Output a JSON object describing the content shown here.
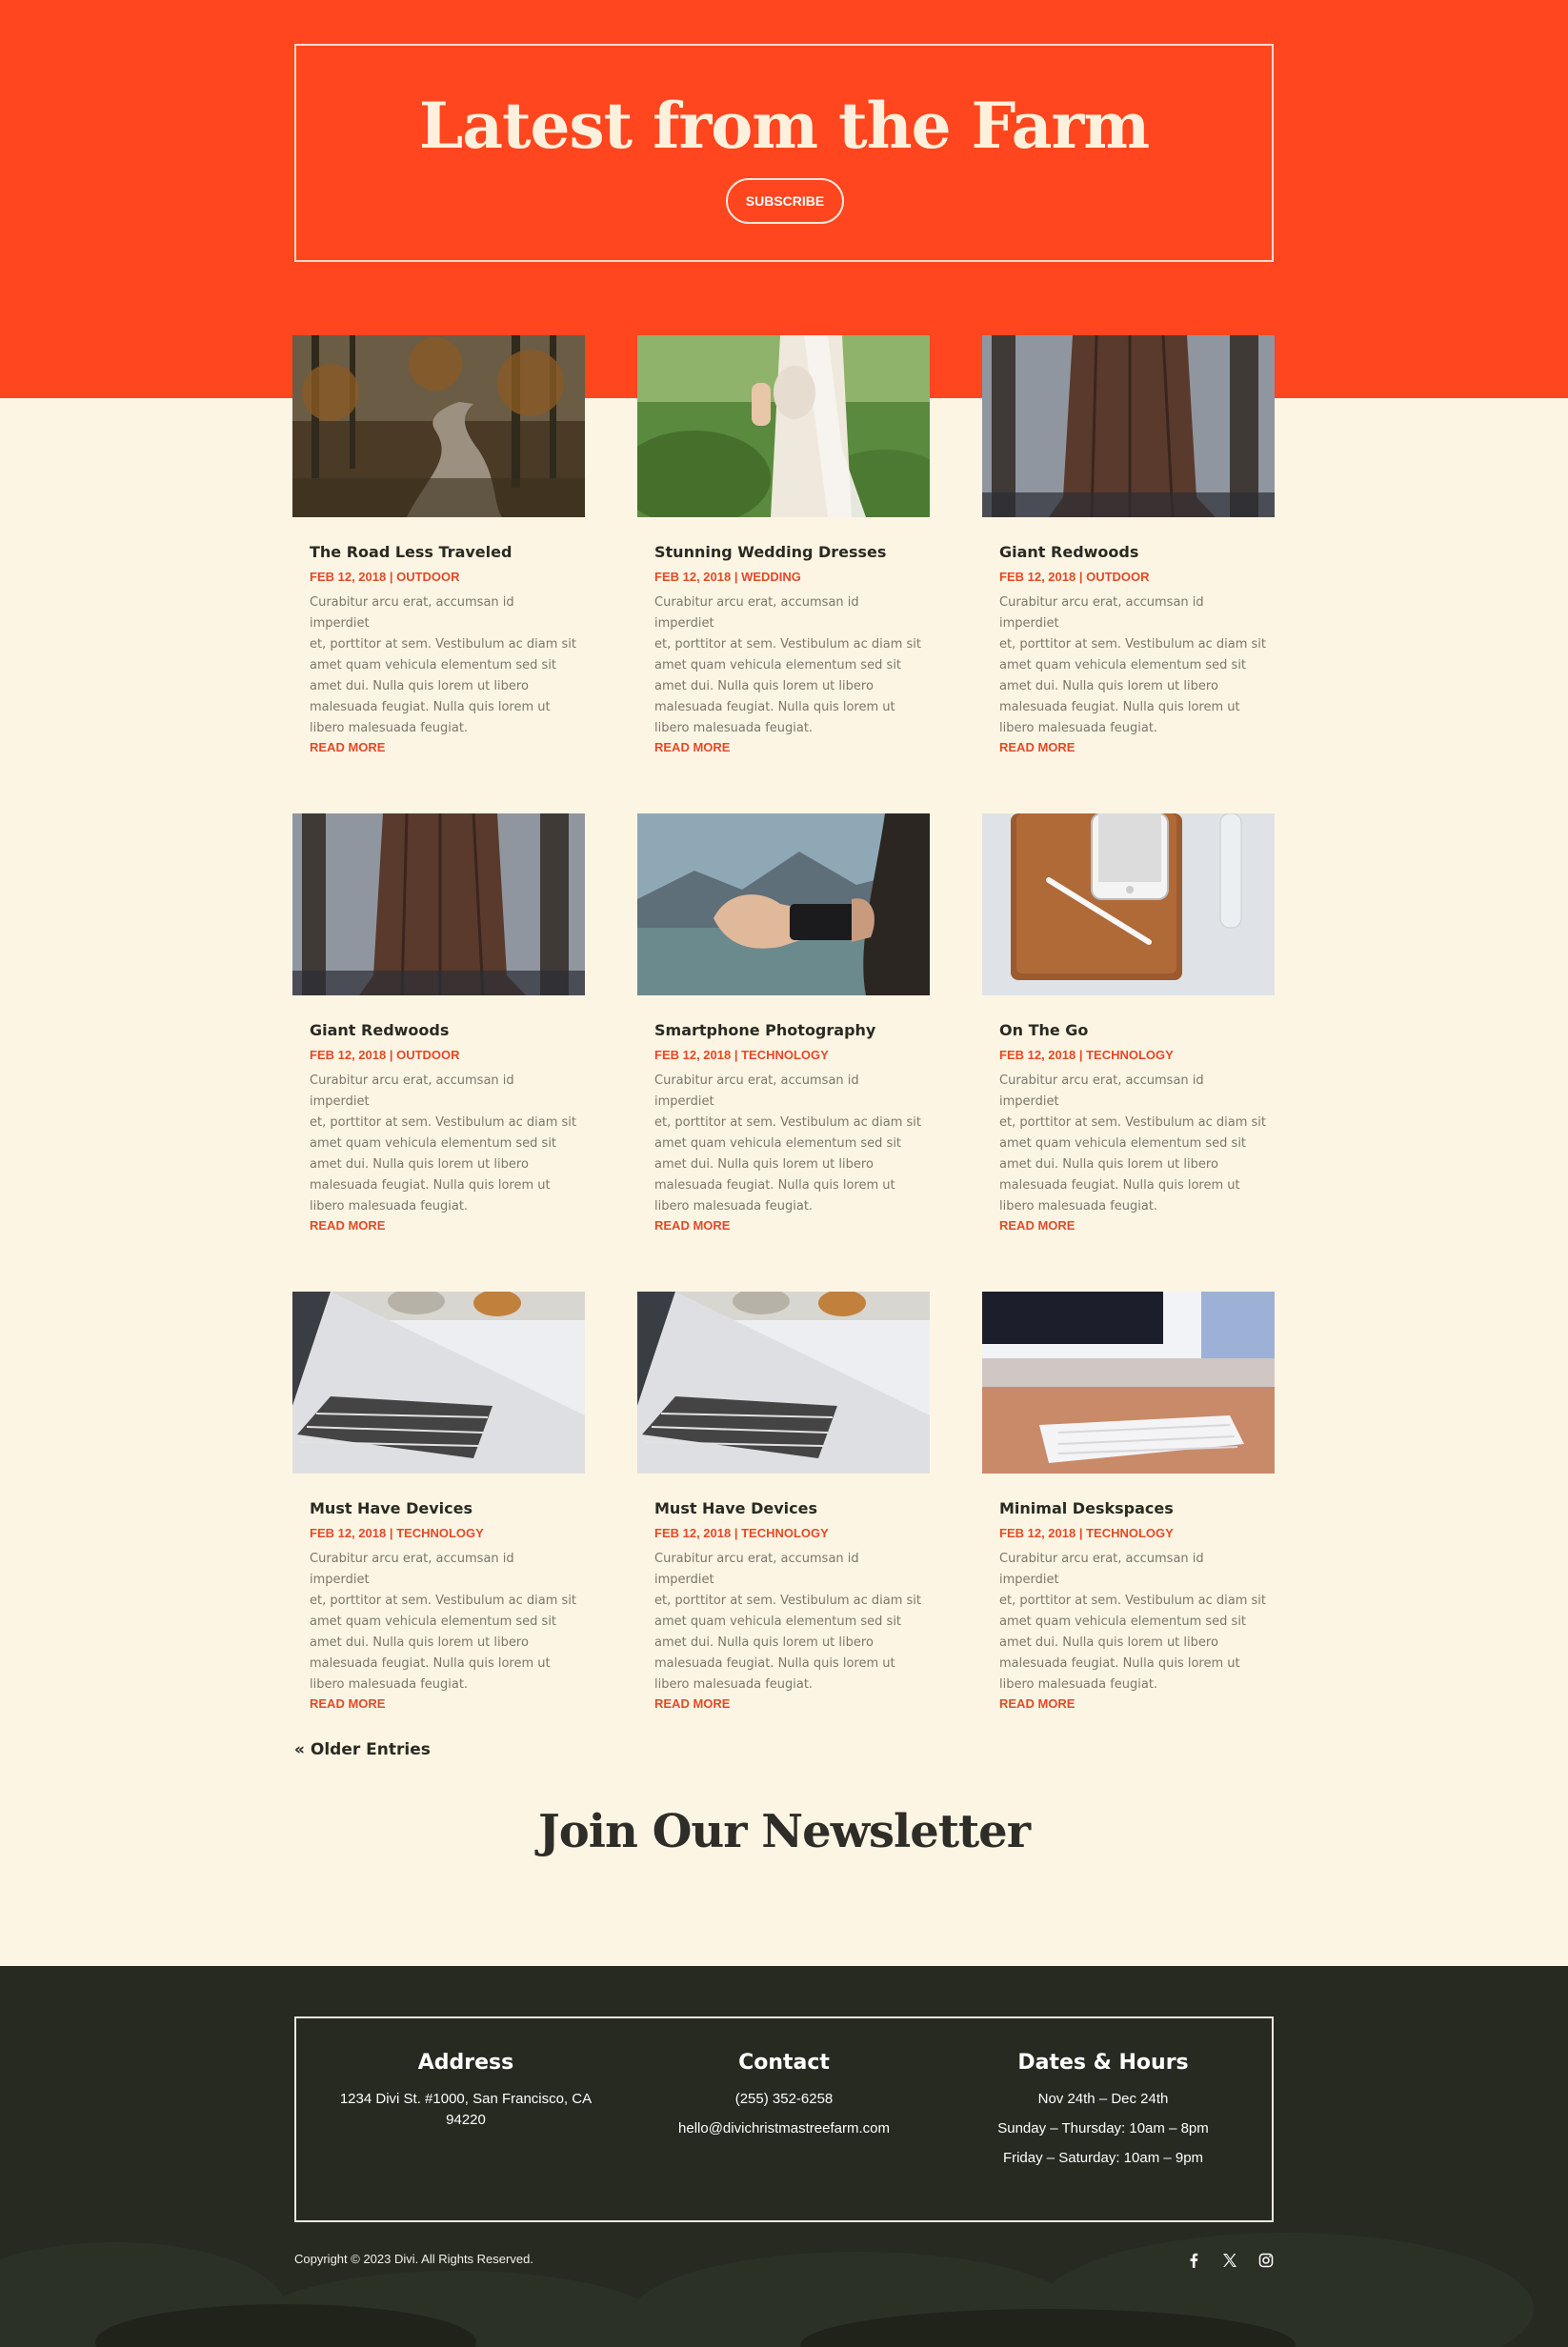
{
  "hero": {
    "title": "Latest from the Farm",
    "subscribe_label": "SUBSCRIBE"
  },
  "posts": [
    {
      "title": "The Road Less Traveled",
      "date": "FEB 12, 2018",
      "category": "OUTDOOR",
      "image": "forest-road-photo"
    },
    {
      "title": "Stunning Wedding Dresses",
      "date": "FEB 12, 2018",
      "category": "WEDDING",
      "image": "bride-dress-photo"
    },
    {
      "title": "Giant Redwoods",
      "date": "FEB 12, 2018",
      "category": "OUTDOOR",
      "image": "redwood-trees-photo"
    },
    {
      "title": "Giant Redwoods",
      "date": "FEB 12, 2018",
      "category": "OUTDOOR",
      "image": "redwood-trees-photo"
    },
    {
      "title": "Smartphone Photography",
      "date": "FEB 12, 2018",
      "category": "TECHNOLOGY",
      "image": "phone-camera-photo"
    },
    {
      "title": "On The Go",
      "date": "FEB 12, 2018",
      "category": "TECHNOLOGY",
      "image": "tablet-phone-photo"
    },
    {
      "title": "Must Have Devices",
      "date": "FEB 12, 2018",
      "category": "TECHNOLOGY",
      "image": "laptop-keyboard-photo"
    },
    {
      "title": "Must Have Devices",
      "date": "FEB 12, 2018",
      "category": "TECHNOLOGY",
      "image": "laptop-keyboard-photo"
    },
    {
      "title": "Minimal Deskspaces",
      "date": "FEB 12, 2018",
      "category": "TECHNOLOGY",
      "image": "desk-keyboard-photo"
    }
  ],
  "excerpt_lines": [
    "Curabitur arcu erat, accumsan id imperdiet",
    "et, porttitor at sem. Vestibulum ac diam sit",
    "amet quam vehicula elementum sed sit",
    "amet dui. Nulla quis lorem ut libero",
    "malesuada feugiat. Nulla quis lorem ut",
    "libero malesuada feugiat."
  ],
  "meta_separator": " | ",
  "read_more_label": "READ MORE",
  "older_entries_label": "« Older Entries",
  "newsletter_title": "Join Our Newsletter",
  "footer": {
    "address": {
      "heading": "Address",
      "line1": "1234 Divi St. #1000, San Francisco, CA",
      "line2": "94220"
    },
    "contact": {
      "heading": "Contact",
      "phone": "(255) 352-6258",
      "email": "hello@divichristmastreefarm.com"
    },
    "hours": {
      "heading": "Dates & Hours",
      "dates": "Nov 24th – Dec 24th",
      "weekdays": "Sunday – Thursday: 10am – 8pm",
      "weekend": "Friday – Saturday: 10am – 9pm"
    },
    "copyright": "Copyright © 2023 Divi. All Rights Reserved.",
    "social": [
      "facebook-icon",
      "x-twitter-icon",
      "instagram-icon"
    ]
  },
  "colors": {
    "accent": "#ff461e",
    "link": "#e34a27",
    "background": "#fdf5e4",
    "footer_bg": "#25281f"
  }
}
